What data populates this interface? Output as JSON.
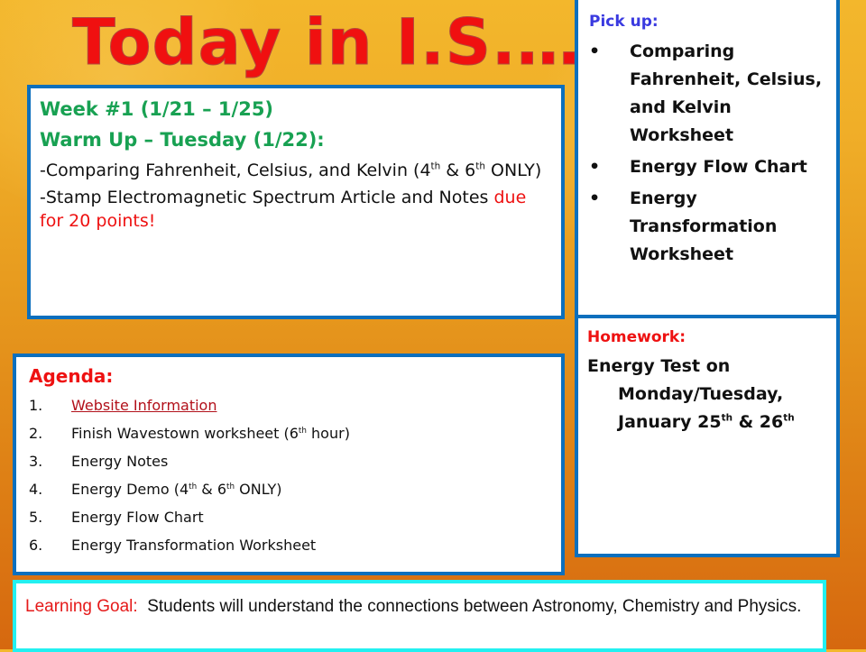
{
  "slide_title": "Today in I.S.…",
  "week_box": {
    "week_heading": "Week #1 (1/21 – 1/25)",
    "warmup_heading": "Warm Up – Tuesday (1/22):",
    "item1_text": "-Comparing Fahrenheit, Celsius, and Kelvin (",
    "item1_sup1_base": "4",
    "item1_sup1": "th",
    "item1_amp": " & ",
    "item1_sup2_base": "6",
    "item1_sup2": "th",
    "item1_tail": " ONLY)",
    "item2_text": "-Stamp Electromagnetic Spectrum Article and Notes ",
    "item2_highlight": "due for 20 points!",
    "highlight_color": "#ee1111"
  },
  "pickup": {
    "heading": "Pick up:",
    "bullet_glyph": "•",
    "items": [
      "Comparing Fahrenheit, Celsius, and Kelvin Worksheet",
      "Energy Flow Chart",
      "Energy Transformation Worksheet"
    ]
  },
  "homework": {
    "heading": "Homework:",
    "text_main": "Energy Test on Monday/Tuesday, January 25",
    "sup1": "th",
    "amp": " & 26",
    "sup2": "th"
  },
  "agenda": {
    "heading": "Agenda:",
    "items": [
      {
        "num": "1.",
        "text": "Website Information",
        "is_link": true
      },
      {
        "num": "2.",
        "text": "Finish Wavestown worksheet (6",
        "sup": "th",
        "tail": " hour)"
      },
      {
        "num": "3.",
        "text": "Energy Notes"
      },
      {
        "num": "4.",
        "text": "Energy Demo (4",
        "sup": "th",
        "mid": " & 6",
        "sup2": "th",
        "tail": " ONLY)"
      },
      {
        "num": "5.",
        "text": "Energy Flow Chart"
      },
      {
        "num": "6.",
        "text": "Energy Transformation Worksheet"
      }
    ]
  },
  "learning_goal": {
    "label": "Learning Goal:",
    "text": "  Students will understand the connections between Astronomy, Chemistry and Physics."
  },
  "colors": {
    "title_red": "#f01010",
    "box_border_blue": "#0c6fbd",
    "goal_border_cyan": "#23f0f0",
    "heading_green": "#18a152",
    "pickup_heading_blue": "#3a3ae0",
    "background_top": "#f3b72c",
    "background_bottom": "#d6680f"
  }
}
